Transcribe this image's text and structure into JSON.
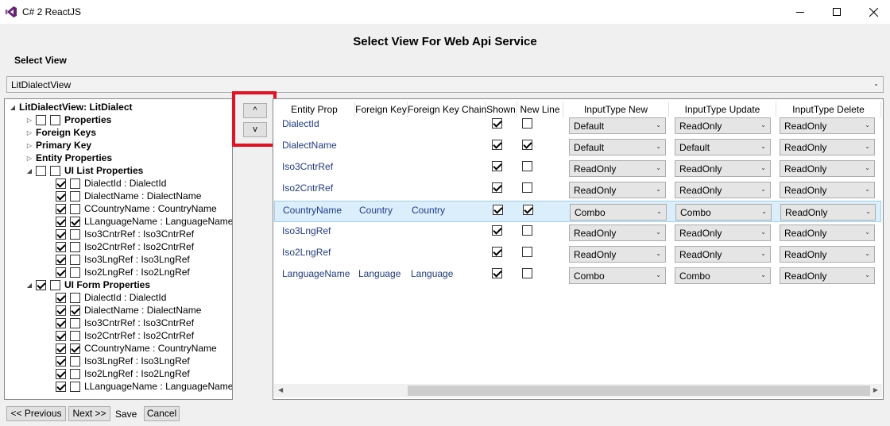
{
  "window": {
    "title": "C# 2 ReactJS"
  },
  "page": {
    "heading": "Select View For Web Api Service",
    "select_label": "Select View"
  },
  "view_select": {
    "value": "LitDialectView"
  },
  "tree": {
    "root": "LitDialectView: LitDialect",
    "properties": "Properties",
    "foreign_keys": "Foreign Keys",
    "primary_key": "Primary Key",
    "entity_properties": "Entity Properties",
    "ui_list": {
      "label": "UI List Properties",
      "items": [
        {
          "label": "DialectId : DialectId",
          "checked1": true,
          "checked2": false
        },
        {
          "label": "DialectName : DialectName",
          "checked1": true,
          "checked2": false
        },
        {
          "label": "CCountryName : CountryName",
          "checked1": true,
          "checked2": false
        },
        {
          "label": "LLanguageName : LanguageName",
          "checked1": true,
          "checked2": true
        },
        {
          "label": "Iso3CntrRef : Iso3CntrRef",
          "checked1": true,
          "checked2": false
        },
        {
          "label": "Iso2CntrRef : Iso2CntrRef",
          "checked1": true,
          "checked2": false
        },
        {
          "label": "Iso3LngRef : Iso3LngRef",
          "checked1": true,
          "checked2": false
        },
        {
          "label": "Iso2LngRef : Iso2LngRef",
          "checked1": true,
          "checked2": false
        }
      ]
    },
    "ui_form": {
      "label": "UI Form Properties",
      "items": [
        {
          "label": "DialectId : DialectId",
          "checked1": true,
          "checked2": false
        },
        {
          "label": "DialectName : DialectName",
          "checked1": true,
          "checked2": true
        },
        {
          "label": "Iso3CntrRef : Iso3CntrRef",
          "checked1": true,
          "checked2": false
        },
        {
          "label": "Iso2CntrRef : Iso2CntrRef",
          "checked1": true,
          "checked2": false
        },
        {
          "label": "CCountryName : CountryName",
          "checked1": true,
          "checked2": true
        },
        {
          "label": "Iso3LngRef : Iso3LngRef",
          "checked1": true,
          "checked2": false
        },
        {
          "label": "Iso2LngRef : Iso2LngRef",
          "checked1": true,
          "checked2": false
        },
        {
          "label": "LLanguageName : LanguageName",
          "checked1": true,
          "checked2": false
        }
      ]
    }
  },
  "order_buttons": {
    "up": "^",
    "down": "v"
  },
  "grid": {
    "columns": [
      "Entity Prop",
      "Foreign Key",
      "Foreign Key Chain",
      "Shown",
      "New Line",
      "InputType New",
      "InputType Update",
      "InputType Delete"
    ],
    "rows": [
      {
        "prop": "DialectId",
        "fk": "",
        "fkc": "",
        "shown": true,
        "newline": false,
        "new": "Default",
        "update": "ReadOnly",
        "delete": "ReadOnly"
      },
      {
        "prop": "DialectName",
        "fk": "",
        "fkc": "",
        "shown": true,
        "newline": true,
        "new": "Default",
        "update": "Default",
        "delete": "ReadOnly"
      },
      {
        "prop": "Iso3CntrRef",
        "fk": "",
        "fkc": "",
        "shown": true,
        "newline": false,
        "new": "ReadOnly",
        "update": "ReadOnly",
        "delete": "ReadOnly"
      },
      {
        "prop": "Iso2CntrRef",
        "fk": "",
        "fkc": "",
        "shown": true,
        "newline": false,
        "new": "ReadOnly",
        "update": "ReadOnly",
        "delete": "ReadOnly"
      },
      {
        "prop": "CountryName",
        "fk": "Country",
        "fkc": "Country",
        "shown": true,
        "newline": true,
        "new": "Combo",
        "update": "Combo",
        "delete": "ReadOnly",
        "selected": true
      },
      {
        "prop": "Iso3LngRef",
        "fk": "",
        "fkc": "",
        "shown": true,
        "newline": false,
        "new": "ReadOnly",
        "update": "ReadOnly",
        "delete": "ReadOnly"
      },
      {
        "prop": "Iso2LngRef",
        "fk": "",
        "fkc": "",
        "shown": true,
        "newline": false,
        "new": "ReadOnly",
        "update": "ReadOnly",
        "delete": "ReadOnly"
      },
      {
        "prop": "LanguageName",
        "fk": "Language",
        "fkc": "Language",
        "shown": true,
        "newline": false,
        "new": "Combo",
        "update": "Combo",
        "delete": "ReadOnly"
      }
    ]
  },
  "footer": {
    "previous": "<< Previous",
    "next": "Next >>",
    "save": "Save",
    "cancel": "Cancel"
  },
  "colors": {
    "highlight": "#e81123",
    "selected_row": "#dbeefb",
    "cell_text": "#1f3a93"
  }
}
